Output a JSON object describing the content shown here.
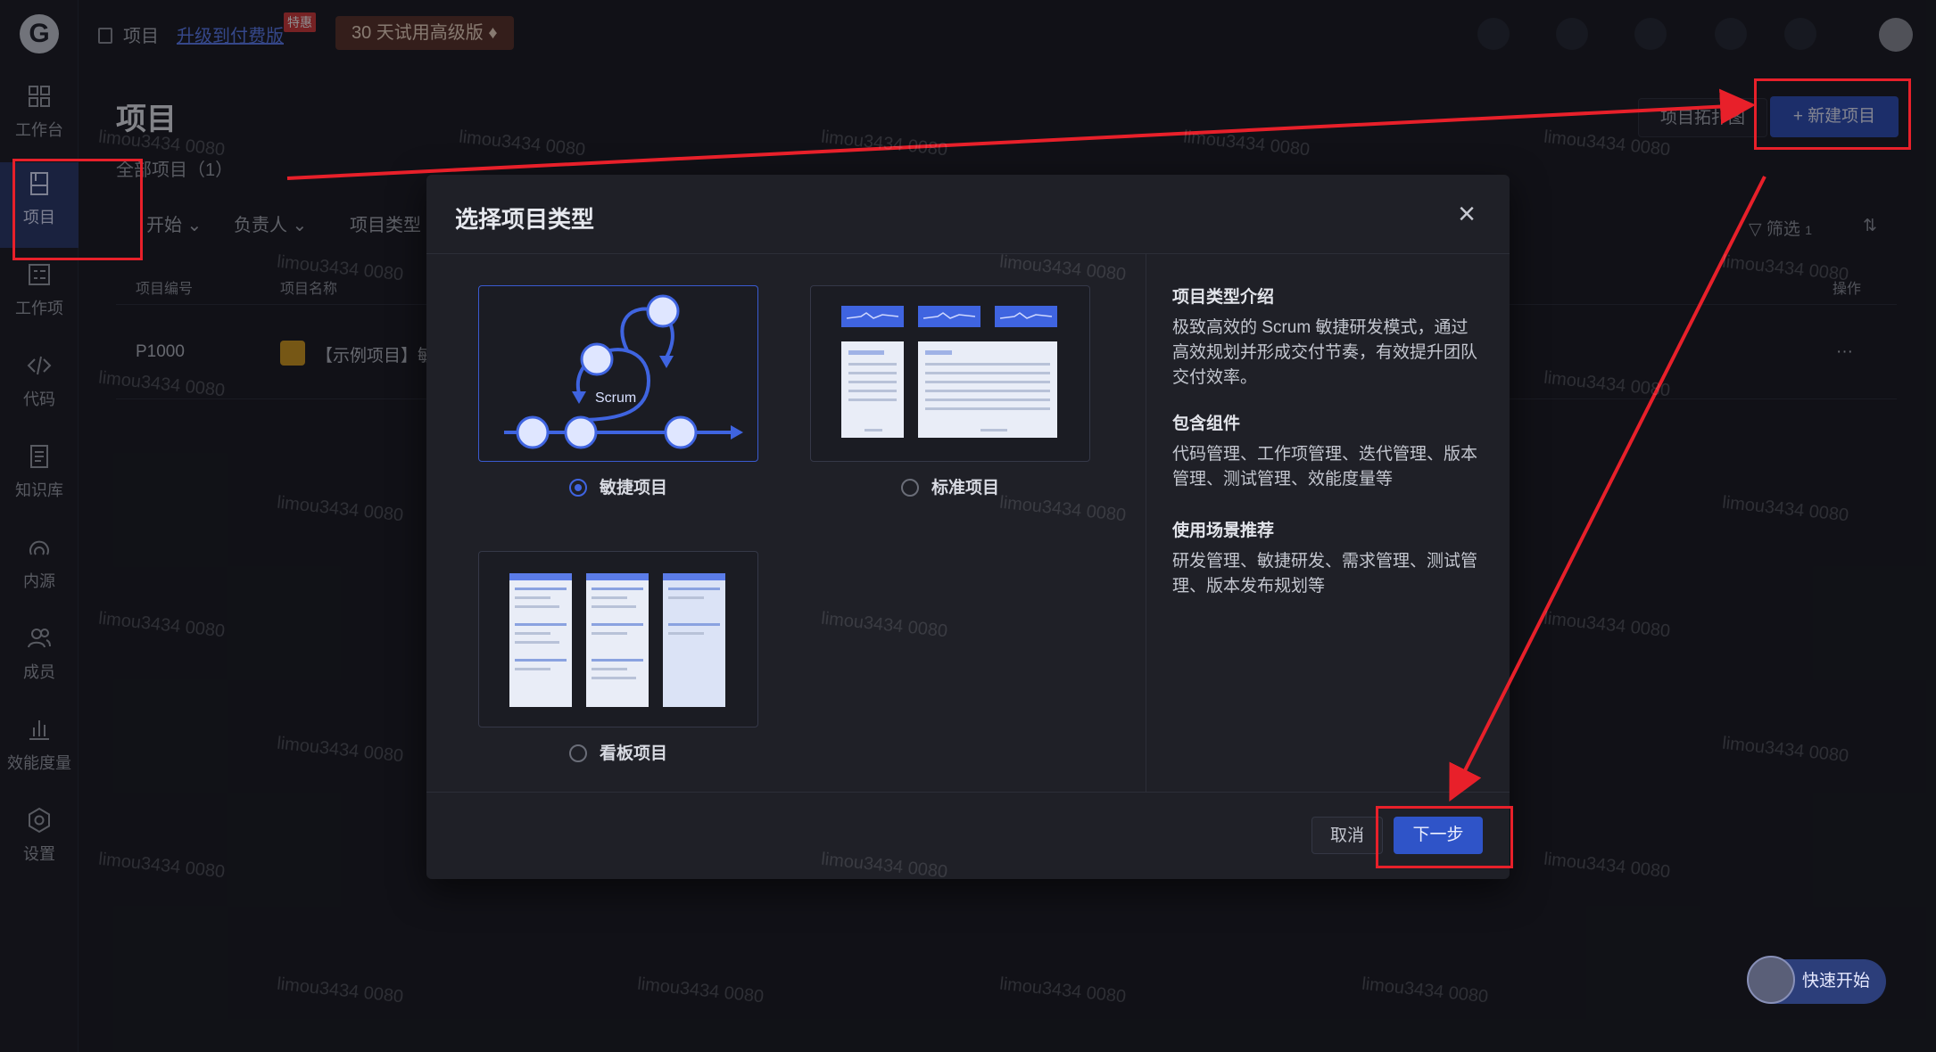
{
  "sidebar": {
    "items": [
      {
        "label": "工作台",
        "icon": "dashboard-icon"
      },
      {
        "label": "项目",
        "icon": "project-icon"
      },
      {
        "label": "工作项",
        "icon": "workitem-icon"
      },
      {
        "label": "代码",
        "icon": "code-icon"
      },
      {
        "label": "知识库",
        "icon": "knowledge-icon"
      },
      {
        "label": "内源",
        "icon": "innersource-icon"
      },
      {
        "label": "成员",
        "icon": "members-icon"
      },
      {
        "label": "效能度量",
        "icon": "metrics-icon"
      },
      {
        "label": "设置",
        "icon": "settings-icon"
      }
    ]
  },
  "topbar": {
    "breadcrumb": "项目",
    "upgrade_link": "升级到付费版",
    "special_badge": "特惠",
    "trial_button": "30 天试用高级版"
  },
  "page": {
    "title": "项目",
    "subtitle": "全部项目（1）",
    "map_button": "项目拓扑图",
    "new_project_button": "+ 新建项目",
    "filters": [
      "开始",
      "负责人",
      "项目类型"
    ],
    "filter_right": "筛选",
    "filter_count": "1",
    "columns": {
      "number": "项目编号",
      "name": "项目名称",
      "actions": "操作"
    },
    "rows": [
      {
        "number": "P1000",
        "name": "【示例项目】敏",
        "actions": "···"
      }
    ]
  },
  "modal": {
    "title": "选择项目类型",
    "options": [
      {
        "label": "敏捷项目",
        "art_text": "Scrum",
        "selected": true
      },
      {
        "label": "标准项目",
        "selected": false
      },
      {
        "label": "看板项目",
        "selected": false
      }
    ],
    "intro_heading": "项目类型介绍",
    "intro_text": "极致高效的 Scrum 敏捷研发模式，通过高效规划并形成交付节奏，有效提升团队交付效率。",
    "components_heading": "包含组件",
    "components_text": "代码管理、工作项管理、迭代管理、版本管理、测试管理、效能度量等",
    "scenarios_heading": "使用场景推荐",
    "scenarios_text": "研发管理、敏捷研发、需求管理、测试管理、版本发布规划等",
    "cancel": "取消",
    "next": "下一步"
  },
  "quick_start": "快速开始",
  "watermark": "limou3434 0080",
  "colors": {
    "accent": "#2f54c8",
    "annotation": "#e8202a",
    "background": "#1a1b22"
  }
}
